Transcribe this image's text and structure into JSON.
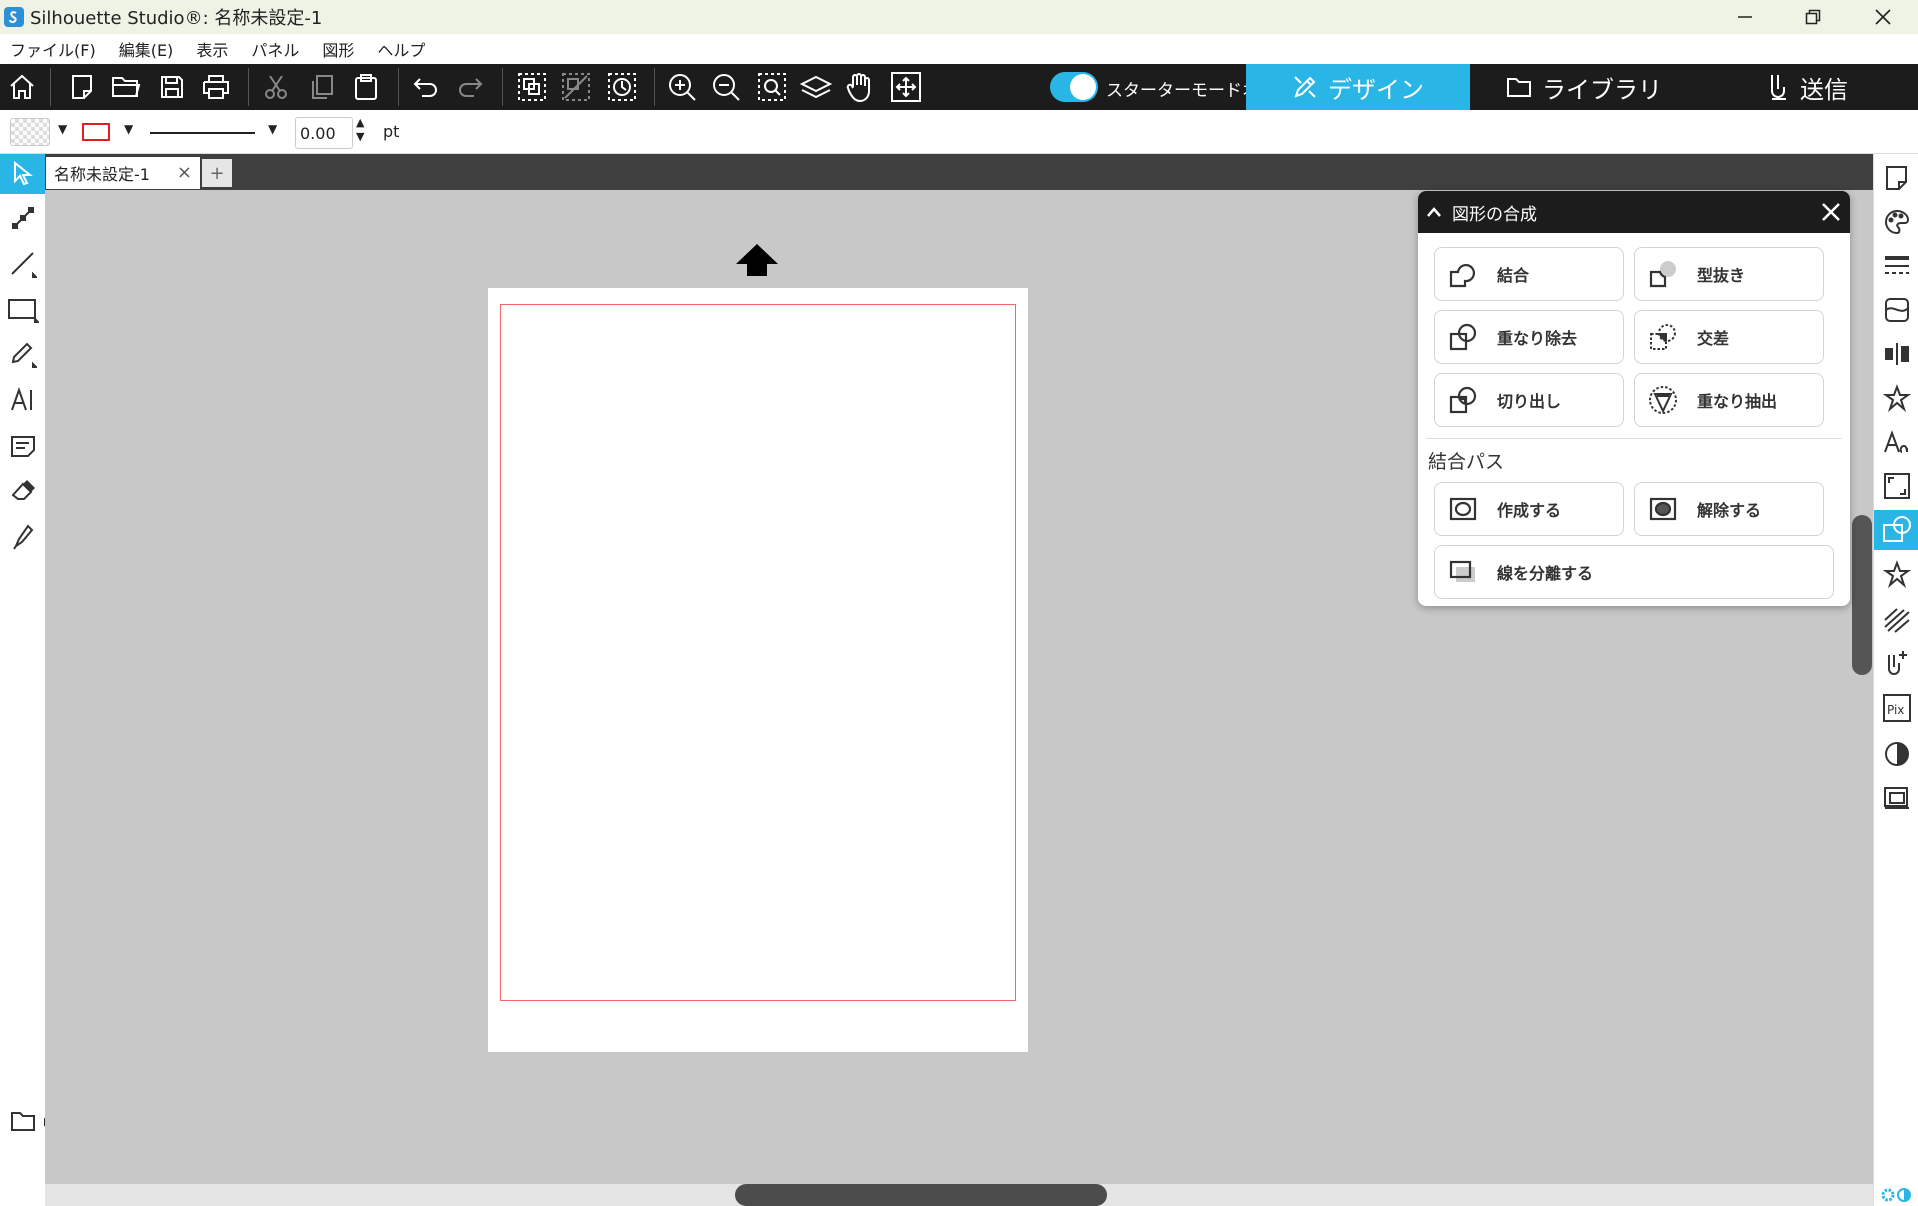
{
  "window": {
    "title": "Silhouette Studio®: 名称未設定-1",
    "controls": [
      "minimize",
      "restore",
      "close"
    ]
  },
  "menu": [
    "ファイル(F)",
    "編集(E)",
    "表示",
    "パネル",
    "図形",
    "ヘルプ"
  ],
  "toolbar": {
    "starter_mode_label": "スターターモードオフ",
    "design_label": "デザイン",
    "library_label": "ライブラリ",
    "send_label": "送信",
    "accent": "#29b6e6"
  },
  "properties": {
    "line_width": "0.00",
    "unit": "pt",
    "line_color": "#e02020"
  },
  "document": {
    "tab_label": "名称未設定-1",
    "close_glyph": "×",
    "add_glyph": "+",
    "cut_border_color": "#f06868"
  },
  "panel": {
    "title": "図形の合成",
    "buttons": {
      "weld": "結合",
      "subtract": "型抜き",
      "subtract_all": "重なり除去",
      "intersect": "交差",
      "crop": "切り出し",
      "divide": "重なり抽出"
    },
    "compound_section_label": "結合パス",
    "compound": {
      "make": "作成する",
      "release": "解除する",
      "separate": "線を分離する"
    }
  }
}
